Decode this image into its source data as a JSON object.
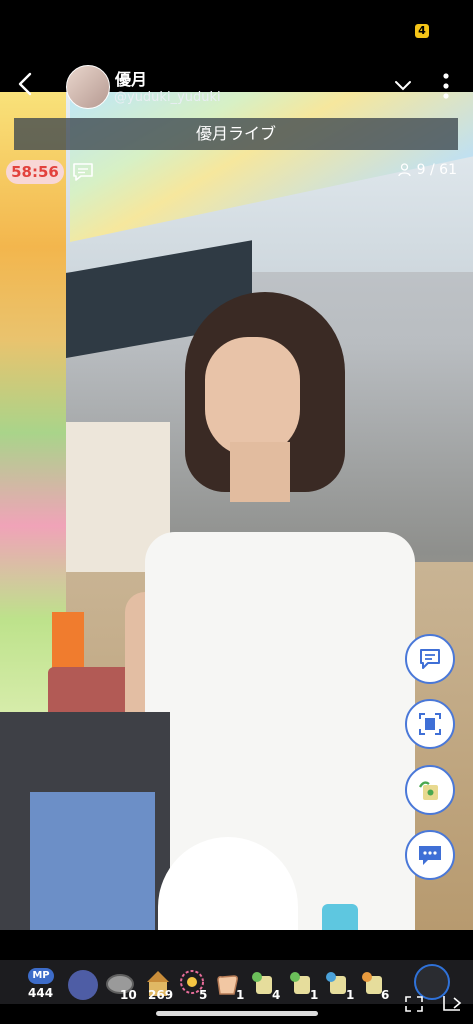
{
  "status": {
    "battery_label": "4"
  },
  "header": {
    "streamer_name": "優月",
    "streamer_handle": "@yuduki_yuduki",
    "back_icon": "chevron-left-icon",
    "menu_icon": "more-vertical-icon",
    "dropdown_icon": "chevron-down-icon"
  },
  "live": {
    "title": "優月ライブ",
    "timer": "58:56",
    "viewers": "9 / 61"
  },
  "actions": [
    {
      "name": "comment-bubble-icon"
    },
    {
      "name": "screen-capture-icon"
    },
    {
      "name": "gift-bag-icon"
    },
    {
      "name": "chat-icon"
    }
  ],
  "tray": {
    "mp_label": "MP",
    "mp_value": "444",
    "gifts": [
      {
        "name": "coin-gift-icon",
        "count": "10"
      },
      {
        "name": "tower-gift-icon",
        "count": "269"
      },
      {
        "name": "firework-gift-icon",
        "count": "5"
      },
      {
        "name": "clap-gift-icon",
        "count": "1"
      },
      {
        "name": "leaf-gift-1-icon",
        "count": "4"
      },
      {
        "name": "leaf-gift-2-icon",
        "count": "1"
      },
      {
        "name": "leaf-gift-3-icon",
        "count": "1"
      },
      {
        "name": "leaf-gift-4-icon",
        "count": "6"
      }
    ]
  },
  "colors": {
    "accent": "#4a78d8",
    "timer_text": "#e2423d",
    "timer_bg": "#f8d7d6"
  }
}
